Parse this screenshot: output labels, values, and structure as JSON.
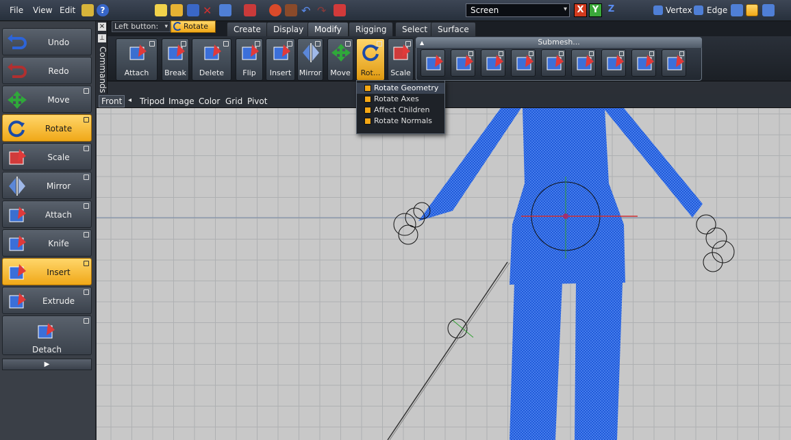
{
  "menubar": {
    "file": "File",
    "view": "View",
    "edit": "Edit",
    "space_select": "Screen",
    "axis_x": "X",
    "axis_y": "Y",
    "axis_z": "Z",
    "mode_vertex": "Vertex",
    "mode_edge": "Edge"
  },
  "left_panel": {
    "items": [
      {
        "label": "Undo",
        "icon": "undo-icon"
      },
      {
        "label": "Redo",
        "icon": "redo-icon"
      },
      {
        "label": "Move",
        "icon": "move-icon"
      },
      {
        "label": "Rotate",
        "icon": "rotate-icon",
        "active": true
      },
      {
        "label": "Scale",
        "icon": "scale-icon"
      },
      {
        "label": "Mirror",
        "icon": "mirror-icon"
      },
      {
        "label": "Attach",
        "icon": "attach-icon"
      },
      {
        "label": "Knife",
        "icon": "knife-icon"
      },
      {
        "label": "Insert",
        "icon": "insert-icon",
        "active": true
      },
      {
        "label": "Extrude",
        "icon": "extrude-icon"
      },
      {
        "label": "Detach",
        "icon": "detach-icon"
      }
    ],
    "more": "▶"
  },
  "commands_tab": {
    "label": "Commands",
    "close": "×",
    "pin": "⊥"
  },
  "left_button": {
    "label": "Left button:",
    "value": "Rotate"
  },
  "tabs": [
    {
      "label": "Create"
    },
    {
      "label": "Display"
    },
    {
      "label": "Modify",
      "active": true
    },
    {
      "label": "Rigging"
    },
    {
      "label": "Select"
    },
    {
      "label": "Surface"
    }
  ],
  "ribbon": {
    "buttons": [
      {
        "label": "Attach"
      },
      {
        "label": "Break"
      },
      {
        "label": "Delete"
      },
      {
        "label": "Flip"
      },
      {
        "label": "Insert"
      },
      {
        "label": "Mirror"
      },
      {
        "label": "Move"
      },
      {
        "label": "Rot...",
        "active": true
      },
      {
        "label": "Scale"
      }
    ],
    "submesh_title": "Submesh..."
  },
  "rotate_menu": [
    {
      "label": "Rotate Geometry",
      "checked": true,
      "highlighted": true
    },
    {
      "label": "Rotate Axes",
      "checked": true
    },
    {
      "label": "Affect Children",
      "checked": true
    },
    {
      "label": "Rotate Normals",
      "checked": true
    }
  ],
  "viewport_header": {
    "view": "Front",
    "arrow": "◂",
    "tripod": "Tripod",
    "image": "Image",
    "color": "Color",
    "grid": "Grid",
    "pivot": "Pivot"
  },
  "colors": {
    "accent": "#f0a818",
    "mesh": "#1f5ad8",
    "grid_bg": "#c8c8c8"
  }
}
